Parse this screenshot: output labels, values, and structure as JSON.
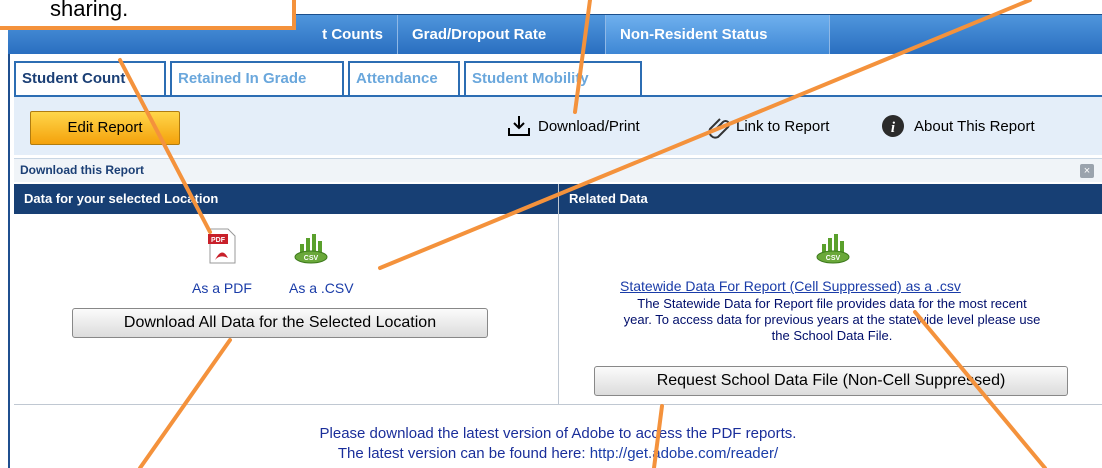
{
  "top_tabs": [
    "t Counts",
    "Grad/Dropout Rate",
    "Non-Resident Status"
  ],
  "sub_tabs": [
    "Student Count",
    "Retained In Grade",
    "Attendance",
    "Student Mobility"
  ],
  "toolbar": {
    "edit_label": "Edit Report",
    "download_label": "Download/Print",
    "link_label": "Link to Report",
    "about_label": "About This Report"
  },
  "download_panel": {
    "title": "Download this Report",
    "left_header": "Data for your selected Location",
    "right_header": "Related Data",
    "pdf_label": "As a PDF",
    "csv_label": "As a .CSV",
    "download_all_label": "Download All Data for the Selected Location",
    "statewide_link": "Statewide Data For Report (Cell Suppressed) as a .csv",
    "statewide_desc_1": "The Statewide Data for Report file provides data for the most recent",
    "statewide_desc_2": "year. To access data for previous years at the statewide level please use",
    "statewide_desc_3": "the School Data File.",
    "request_label": "Request School Data File (Non-Cell Suppressed)"
  },
  "bottom_note": {
    "line1": "Please download the latest version of Adobe to access the PDF reports.",
    "line2_prefix": "The latest version can be found here: ",
    "line2_link": "http://get.adobe.com/reader/"
  },
  "callout_text": "sharing.",
  "colors": {
    "accent_orange": "#f4923c",
    "header_navy": "#173f74",
    "tab_blue": "#2a6fc0",
    "edit_yellow": "#f4a20c"
  }
}
